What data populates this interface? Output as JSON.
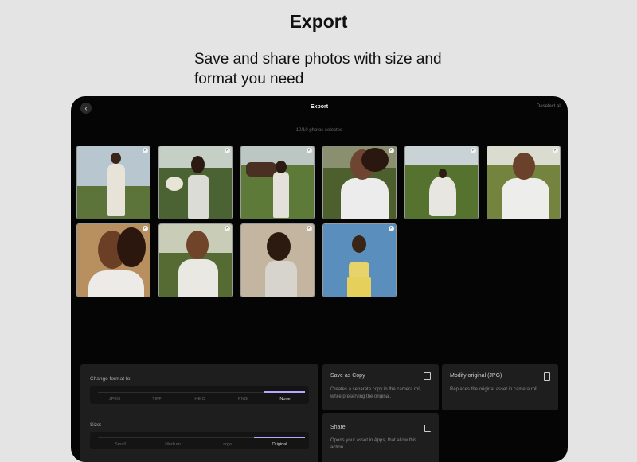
{
  "promo": {
    "title": "Export",
    "subtitle": "Save and share photos with size and format you need"
  },
  "screen": {
    "back_icon": "chevron-left-icon",
    "title": "Export",
    "deselect_label": "Deselect all",
    "selected_count": "10/10 photos selected"
  },
  "photos": [
    {
      "id": 1,
      "selected": true
    },
    {
      "id": 2,
      "selected": true
    },
    {
      "id": 3,
      "selected": true
    },
    {
      "id": 4,
      "selected": true
    },
    {
      "id": 5,
      "selected": true
    },
    {
      "id": 6,
      "selected": true
    },
    {
      "id": 7,
      "selected": true
    },
    {
      "id": 8,
      "selected": true
    },
    {
      "id": 9,
      "selected": true
    },
    {
      "id": 10,
      "selected": true
    }
  ],
  "format": {
    "label": "Change format to:",
    "options": [
      "JPEG",
      "TIFF",
      "HEIC",
      "PNG",
      "None"
    ],
    "selected": "None"
  },
  "size": {
    "label": "Size:",
    "options": [
      "Small",
      "Medium",
      "Large",
      "Original"
    ],
    "selected": "Original"
  },
  "actions": {
    "save_copy": {
      "title": "Save as Copy",
      "description": "Creates a separate copy in the camera roll, while preserving the original.",
      "icon": "duplicate-icon"
    },
    "modify_original": {
      "title": "Modify original (JPG)",
      "description": "Replaces the original asset in camera roll.",
      "icon": "phone-icon"
    },
    "share": {
      "title": "Share",
      "description": "Opens your asset in Apps, that allow this action.",
      "icon": "share-icon"
    }
  },
  "colors": {
    "accent": "#b9a6ff",
    "screen_bg": "#050505",
    "panel_bg": "#1e1e1e",
    "page_bg": "#e4e4e4"
  }
}
